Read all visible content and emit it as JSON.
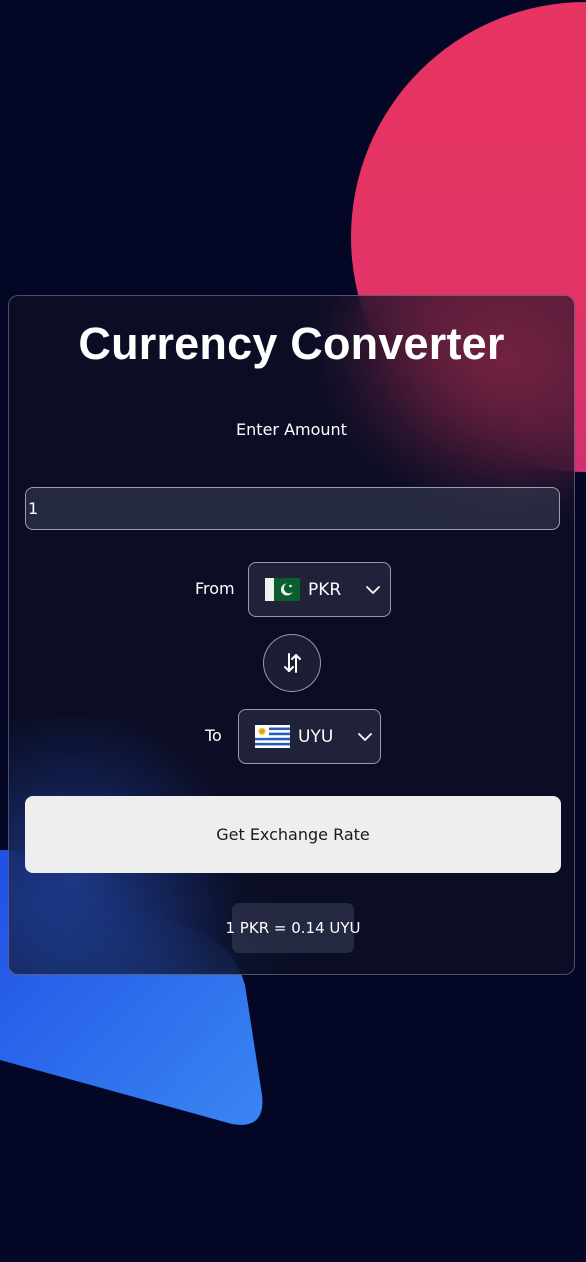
{
  "app": {
    "title": "Currency Converter"
  },
  "amount": {
    "label": "Enter Amount",
    "value": "1"
  },
  "from": {
    "label": "From",
    "currency": "PKR",
    "flag_icon": "pakistan-flag-icon"
  },
  "to": {
    "label": "To",
    "currency": "UYU",
    "flag_icon": "uruguay-flag-icon"
  },
  "actions": {
    "swap_icon": "swap-arrows-icon",
    "get_rate_label": "Get Exchange Rate"
  },
  "result": {
    "text": "1 PKR = 0.14 UYU"
  },
  "colors": {
    "background": "#040625",
    "accent_circle": "#e73461",
    "accent_triangle": "#2f6cf0",
    "button_bg": "#eeeeee"
  }
}
